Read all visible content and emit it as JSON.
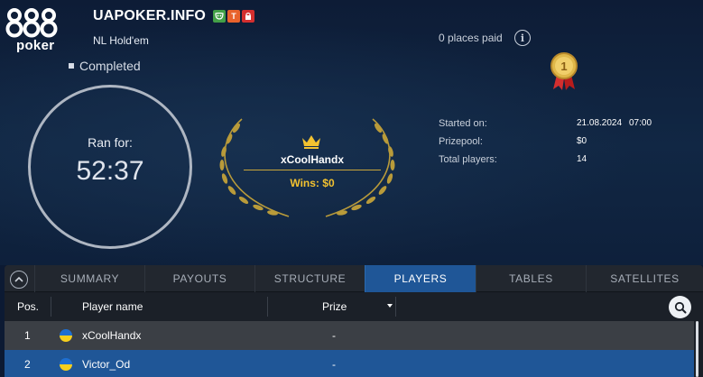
{
  "brand": {
    "digits": "888",
    "word": "poker"
  },
  "tournament": {
    "title": "UAPOKER.INFO",
    "badges": [
      {
        "icon": "mask-icon",
        "color": "#43a047"
      },
      {
        "label": "T",
        "color": "#e8622c"
      },
      {
        "icon": "lock-icon",
        "color": "#d32f2f"
      }
    ],
    "game": "NL Hold'em",
    "status": "Completed",
    "ran_for_label": "Ran for:",
    "ran_for_value": "52:37"
  },
  "winner": {
    "name": "xCoolHandx",
    "wins": "Wins: $0"
  },
  "places_paid": "0 places paid",
  "details": {
    "started_label": "Started on:",
    "started_date": "21.08.2024",
    "started_time": "07:00",
    "prizepool_label": "Prizepool:",
    "prizepool_value": "$0",
    "players_label": "Total players:",
    "players_value": "14"
  },
  "tabs": [
    "SUMMARY",
    "PAYOUTS",
    "STRUCTURE",
    "PLAYERS",
    "TABLES",
    "SATELLITES"
  ],
  "active_tab": "PLAYERS",
  "table": {
    "headers": {
      "pos": "Pos.",
      "player": "Player name",
      "prize": "Prize"
    },
    "rows": [
      {
        "pos": "1",
        "name": "xCoolHandx",
        "prize": "-",
        "flag": "ukraine-flag-icon"
      },
      {
        "pos": "2",
        "name": "Victor_Od",
        "prize": "-",
        "flag": "ukraine-flag-icon"
      }
    ]
  },
  "colors": {
    "accent": "#1f5697",
    "gold": "#f2c230",
    "background": "#0c1a33"
  }
}
